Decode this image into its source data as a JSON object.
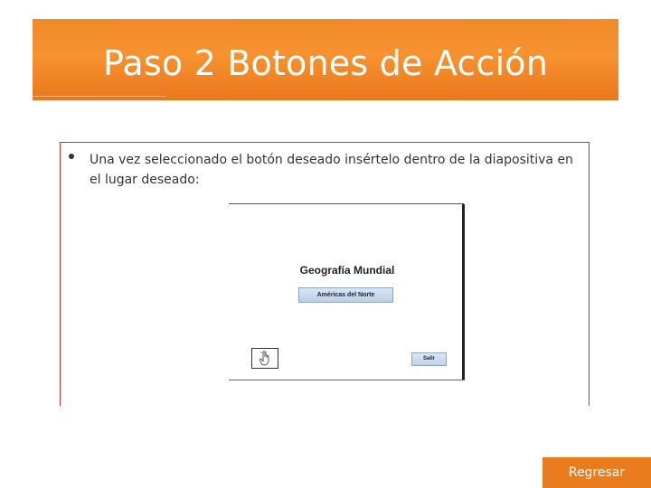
{
  "header": {
    "title": "Paso 2 Botones de Acción"
  },
  "content": {
    "bullet_text": "Una vez seleccionado el botón deseado insértelo dentro de la diapositiva en el lugar deseado:"
  },
  "slide_preview": {
    "title": "Geografía Mundial",
    "region_button_label": "Américas del Norte",
    "exit_button_label": "Salir",
    "home_icon": "hand-pointer-icon"
  },
  "footer": {
    "back_button_label": "Regresar"
  },
  "colors": {
    "accent_orange": "#f7922f",
    "frame_red": "#c0392b",
    "button_blue": "#bcd0e4"
  }
}
